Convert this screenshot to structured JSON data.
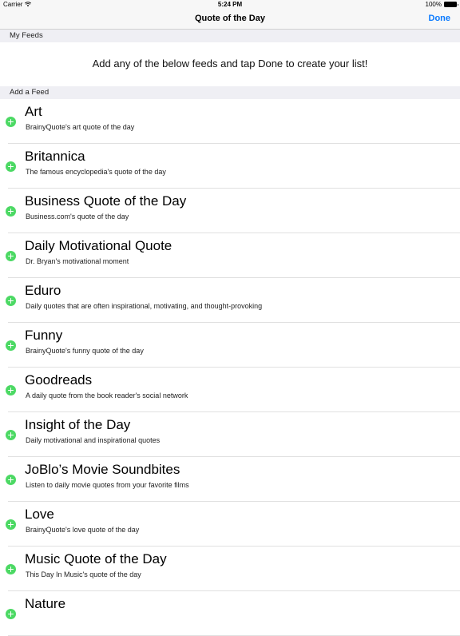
{
  "status_bar": {
    "carrier": "Carrier",
    "time": "5:24 PM",
    "battery_text": "100%",
    "icons": [
      "wifi-icon",
      "battery-icon"
    ]
  },
  "nav": {
    "title": "Quote of the Day",
    "done_label": "Done"
  },
  "my_feeds": {
    "header": "My Feeds",
    "empty_message": "Add any of the below feeds and tap Done to create your list!"
  },
  "add_feed": {
    "header": "Add a Feed",
    "items": [
      {
        "title": "Art",
        "subtitle": "BrainyQuote's art quote of the day"
      },
      {
        "title": "Britannica",
        "subtitle": "The famous encyclopedia's quote of the day"
      },
      {
        "title": "Business Quote of the Day",
        "subtitle": "Business.com's quote of the day"
      },
      {
        "title": "Daily Motivational Quote",
        "subtitle": "Dr. Bryan's motivational moment"
      },
      {
        "title": "Eduro",
        "subtitle": "Daily quotes that are often inspirational, motivating, and thought-provoking"
      },
      {
        "title": "Funny",
        "subtitle": "BrainyQuote's funny quote of the day"
      },
      {
        "title": "Goodreads",
        "subtitle": "A daily quote from the book reader's social network"
      },
      {
        "title": "Insight of the Day",
        "subtitle": "Daily motivational and inspirational quotes"
      },
      {
        "title": "JoBlo’s Movie Soundbites",
        "subtitle": "Listen to daily movie quotes from your favorite films"
      },
      {
        "title": "Love",
        "subtitle": "BrainyQuote's love quote of the day"
      },
      {
        "title": "Music Quote of the Day",
        "subtitle": "This Day In Music's quote of the day"
      },
      {
        "title": "Nature",
        "subtitle": ""
      }
    ]
  },
  "colors": {
    "accent": "#0a7aff",
    "add_icon": "#4cd964",
    "section_background": "#efeff4"
  }
}
